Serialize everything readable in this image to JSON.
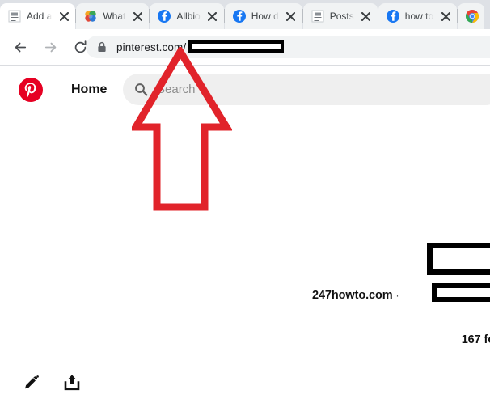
{
  "browser": {
    "tabs": [
      {
        "title": "Add a",
        "favicon": "document-gray-icon",
        "active": true,
        "close_label": "✕"
      },
      {
        "title": "What",
        "favicon": "colorful-flower-icon",
        "active": false,
        "close_label": "✕"
      },
      {
        "title": "Allbio",
        "favicon": "facebook-icon",
        "active": false,
        "close_label": "✕"
      },
      {
        "title": "How d",
        "favicon": "facebook-icon",
        "active": false,
        "close_label": "✕"
      },
      {
        "title": "Posts",
        "favicon": "document-gray-icon",
        "active": false,
        "close_label": "✕"
      },
      {
        "title": "how to",
        "favicon": "facebook-icon",
        "active": false,
        "close_label": "✕"
      },
      {
        "title": "",
        "favicon": "chrome-icon",
        "active": false,
        "close_label": "✕"
      }
    ],
    "toolbar": {
      "back_icon": "back-arrow-icon",
      "forward_icon": "forward-arrow-icon",
      "reload_icon": "reload-icon",
      "lock_icon": "lock-icon",
      "url": "pinterest.com/",
      "url_redacted": true
    }
  },
  "pinterest": {
    "logo_icon": "pinterest-logo-icon",
    "home_label": "Home",
    "search": {
      "icon": "search-icon",
      "placeholder": "Search",
      "value": ""
    },
    "profile_meta": {
      "domain": "247howto.com",
      "separator": "·",
      "redacted_name": true,
      "redacted_detail": true,
      "followers": "167 fo"
    },
    "bottom_actions": [
      {
        "icon": "pencil-edit-icon",
        "label": "Edit"
      },
      {
        "icon": "share-upload-icon",
        "label": "Share"
      }
    ]
  },
  "annotation": {
    "arrow": {
      "icon": "red-up-arrow-icon",
      "color": "#e1232a",
      "direction": "up",
      "points_at": "pinterest.com/ username in address bar"
    }
  },
  "colors": {
    "tabstrip_bg": "#dee1e6",
    "tab_inactive_bg": "#f1f3f4",
    "tab_active_bg": "#ffffff",
    "omnibox_bg": "#f1f3f4",
    "page_bg": "#ffffff",
    "search_bg": "#efefef",
    "pinterest_red": "#e60023",
    "facebook_blue": "#1877f2",
    "annotation_red": "#e1232a",
    "redaction_black": "#000000"
  }
}
